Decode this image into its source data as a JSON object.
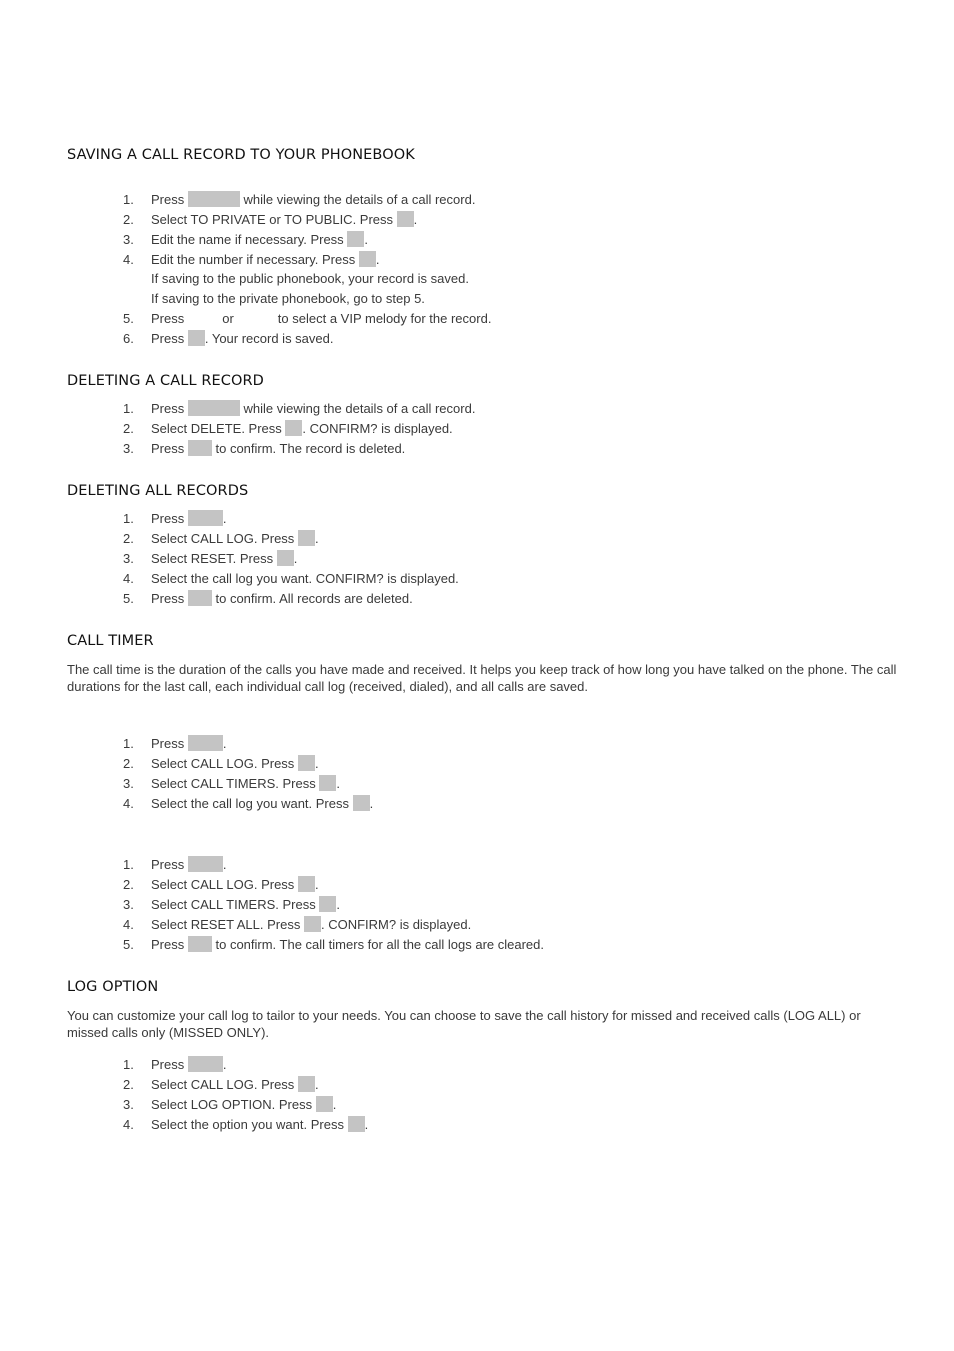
{
  "sections": {
    "saving": {
      "title": "SAVING A CALL RECORD TO YOUR PHONEBOOK",
      "steps": [
        {
          "num": "1.",
          "a": "Press",
          "b": "while viewing the details of a call record."
        },
        {
          "num": "2.",
          "a": "Select TO PRIVATE or TO PUBLIC. Press",
          "b": "."
        },
        {
          "num": "3.",
          "a": "Edit the name if necessary. Press",
          "b": "."
        },
        {
          "num": "4.",
          "a": "Edit the number if necessary. Press",
          "b": ".",
          "extra1": "If saving to the public phonebook, your record is saved.",
          "extra2": "If saving to the private phonebook, go to step 5."
        },
        {
          "num": "5.",
          "a": "Press",
          "or": "or",
          "b": "to select a VIP melody for the record."
        },
        {
          "num": "6.",
          "a": "Press",
          "b": ". Your record is saved."
        }
      ]
    },
    "deleting_one": {
      "title": "DELETING A CALL RECORD",
      "steps": [
        {
          "num": "1.",
          "a": "Press",
          "b": "while viewing the details of a call record."
        },
        {
          "num": "2.",
          "a": "Select DELETE. Press",
          "b": ". CONFIRM? is displayed."
        },
        {
          "num": "3.",
          "a": "Press",
          "b": "to confirm. The record is deleted."
        }
      ]
    },
    "deleting_all": {
      "title": "DELETING ALL RECORDS",
      "steps": [
        {
          "num": "1.",
          "a": "Press",
          "b": "."
        },
        {
          "num": "2.",
          "a": "Select CALL LOG. Press",
          "b": "."
        },
        {
          "num": "3.",
          "a": "Select RESET. Press",
          "b": "."
        },
        {
          "num": "4.",
          "a": "Select the call log you want. CONFIRM? is displayed."
        },
        {
          "num": "5.",
          "a": "Press",
          "b": "to confirm. All records are deleted."
        }
      ]
    },
    "call_timer": {
      "title": "CALL TIMER",
      "paragraph": "The call time is the duration of the calls you have made and received. It helps you keep track of how long you have talked on the phone. The call durations for the last call, each individual call log (received, dialed), and all calls are saved.",
      "view_steps": [
        {
          "num": "1.",
          "a": "Press",
          "b": "."
        },
        {
          "num": "2.",
          "a": "Select CALL LOG. Press",
          "b": "."
        },
        {
          "num": "3.",
          "a": "Select CALL TIMERS. Press",
          "b": "."
        },
        {
          "num": "4.",
          "a": "Select the call log you want. Press",
          "b": "."
        }
      ],
      "reset_steps": [
        {
          "num": "1.",
          "a": "Press",
          "b": "."
        },
        {
          "num": "2.",
          "a": "Select CALL LOG. Press",
          "b": "."
        },
        {
          "num": "3.",
          "a": "Select CALL TIMERS. Press",
          "b": "."
        },
        {
          "num": "4.",
          "a": "Select RESET ALL. Press",
          "b": ". CONFIRM? is displayed."
        },
        {
          "num": "5.",
          "a": "Press",
          "b": "to confirm. The call timers for all the call logs are cleared."
        }
      ]
    },
    "log_option": {
      "title": "LOG OPTION",
      "paragraph": "You can customize your call log to tailor to your needs. You can choose to save the call history for missed and received calls (LOG ALL) or missed calls only (MISSED ONLY).",
      "steps": [
        {
          "num": "1.",
          "a": "Press",
          "b": "."
        },
        {
          "num": "2.",
          "a": "Select CALL LOG. Press",
          "b": "."
        },
        {
          "num": "3.",
          "a": "Select LOG OPTION. Press",
          "b": "."
        },
        {
          "num": "4.",
          "a": "Select the option you want. Press",
          "b": "."
        }
      ]
    }
  }
}
